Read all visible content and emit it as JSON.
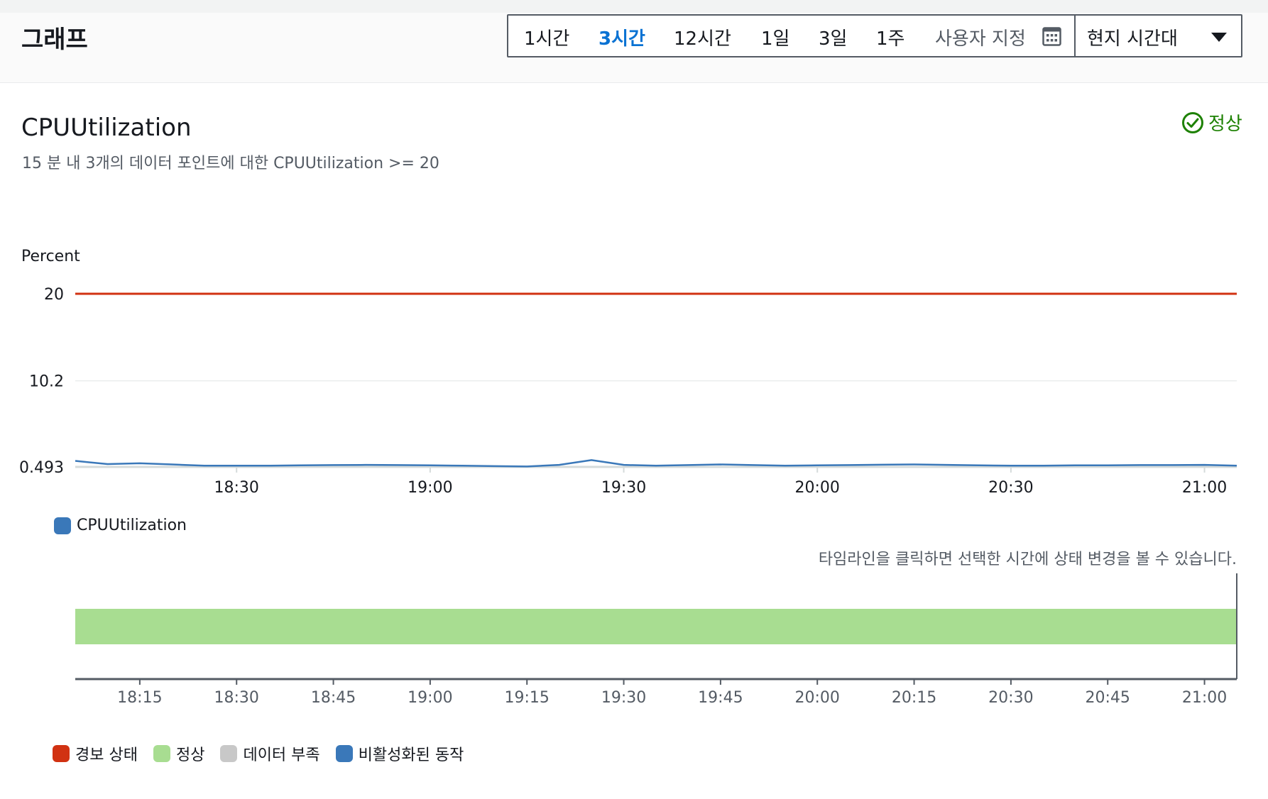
{
  "header": {
    "title": "그래프",
    "ranges": [
      {
        "label": "1시간",
        "active": false
      },
      {
        "label": "3시간",
        "active": true
      },
      {
        "label": "12시간",
        "active": false
      },
      {
        "label": "1일",
        "active": false
      },
      {
        "label": "3일",
        "active": false
      },
      {
        "label": "1주",
        "active": false
      }
    ],
    "custom_label": "사용자 지정",
    "timezone_label": "현지 시간대"
  },
  "alarm": {
    "name": "CPUUtilization",
    "condition": "15 분 내 3개의 데이터 포인트에 대한 CPUUtilization >= 20",
    "state_label": "정상"
  },
  "timeline": {
    "hint": "타임라인을 클릭하면 선택한 시간에 상태 변경을 볼 수 있습니다.",
    "ticks": [
      "18:15",
      "18:30",
      "18:45",
      "19:00",
      "19:15",
      "19:30",
      "19:45",
      "20:00",
      "20:15",
      "20:30",
      "20:45",
      "21:00"
    ],
    "state": "정상",
    "state_range": [
      "18:05",
      "21:05"
    ],
    "legend": [
      {
        "label": "경보 상태",
        "color": "#d13212"
      },
      {
        "label": "정상",
        "color": "#a8dd91"
      },
      {
        "label": "데이터 부족",
        "color": "#c8c8c8"
      },
      {
        "label": "비활성화된 동작",
        "color": "#3a78b9"
      }
    ]
  },
  "colors": {
    "series": "#3a78b9",
    "threshold": "#d13212",
    "ok": "#1d8102",
    "active": "#0972d3"
  },
  "chart_data": {
    "type": "line",
    "title": "CPUUtilization",
    "ylabel": "Percent",
    "ylim": [
      0.493,
      20
    ],
    "yticks": [
      "20",
      "10.2",
      "0.493"
    ],
    "xticks": [
      "18:30",
      "19:00",
      "19:30",
      "20:00",
      "20:30",
      "21:00"
    ],
    "threshold": {
      "value": 20,
      "color": "#d13212"
    },
    "legend_position": "bottom-left",
    "grid": true,
    "series": [
      {
        "name": "CPUUtilization",
        "color": "#3a78b9",
        "x": [
          "18:05",
          "18:10",
          "18:15",
          "18:20",
          "18:25",
          "18:30",
          "18:35",
          "18:40",
          "18:45",
          "18:50",
          "18:55",
          "19:00",
          "19:05",
          "19:10",
          "19:15",
          "19:20",
          "19:25",
          "19:30",
          "19:35",
          "19:40",
          "19:45",
          "19:50",
          "19:55",
          "20:00",
          "20:05",
          "20:10",
          "20:15",
          "20:20",
          "20:25",
          "20:30",
          "20:35",
          "20:40",
          "20:45",
          "20:50",
          "20:55",
          "21:00",
          "21:05"
        ],
        "values": [
          1.17,
          0.81,
          0.9,
          0.77,
          0.63,
          0.63,
          0.63,
          0.67,
          0.7,
          0.72,
          0.7,
          0.67,
          0.63,
          0.58,
          0.54,
          0.72,
          1.26,
          0.72,
          0.63,
          0.7,
          0.77,
          0.7,
          0.63,
          0.67,
          0.7,
          0.74,
          0.77,
          0.72,
          0.67,
          0.63,
          0.63,
          0.67,
          0.67,
          0.7,
          0.7,
          0.72,
          0.63
        ]
      }
    ]
  }
}
